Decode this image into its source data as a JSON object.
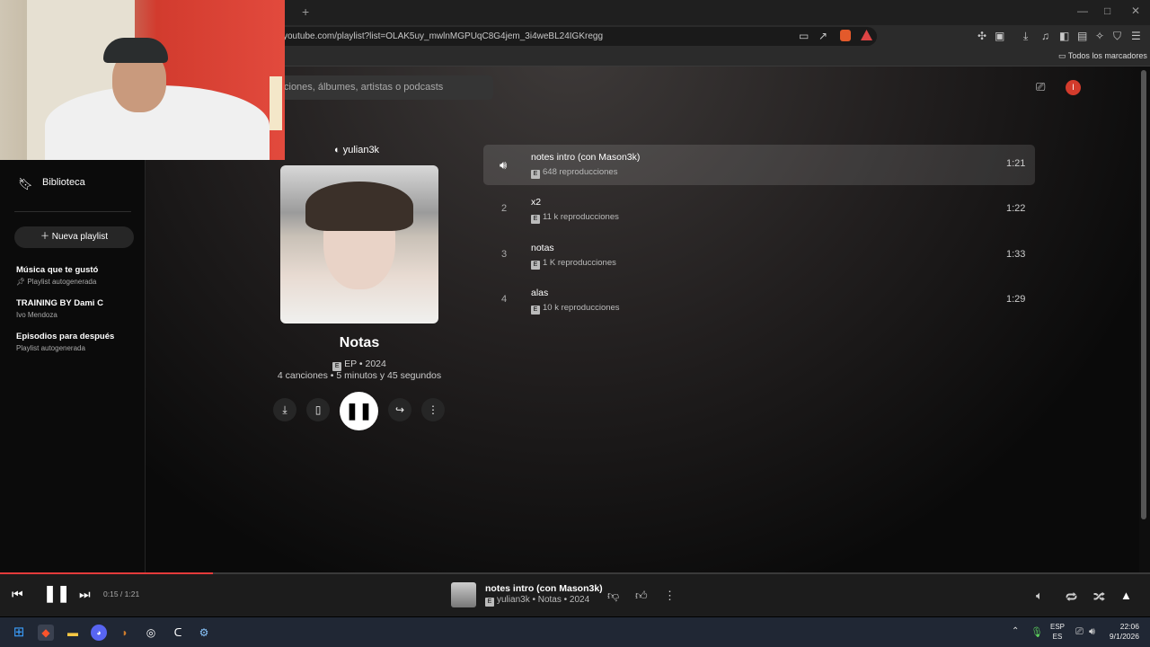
{
  "browser": {
    "url": "youtube.com/playlist?list=OLAK5uy_mwlnMGPUqC8G4jem_3i4weBL24IGKregg",
    "new_tab_label": "+",
    "bookmarks_label": "Todos los marcadores"
  },
  "header": {
    "search_placeholder": "ciones, álbumes, artistas o podcasts",
    "avatar_letter": "I"
  },
  "sidebar": {
    "library_label": "Biblioteca",
    "new_playlist_label": "Nueva playlist",
    "playlists": [
      {
        "title": "Música que te gustó",
        "subtitle": "Playlist autogenerada"
      },
      {
        "title": "TRAINING BY Dami C",
        "subtitle": "Ivo Mendoza"
      },
      {
        "title": "Episodios para después",
        "subtitle": "Playlist autogenerada"
      }
    ]
  },
  "album": {
    "artist": "yulian3k",
    "title": "Notas",
    "badge": "E",
    "type_year": "EP • 2024",
    "summary": "4 canciones • 5 minutos y 45 segundos"
  },
  "tracks": [
    {
      "number": "",
      "title": "notes intro (con Mason3k)",
      "plays": "648 reproducciones",
      "duration": "1:21"
    },
    {
      "number": "2",
      "title": "x2",
      "plays": "11 k reproducciones",
      "duration": "1:22"
    },
    {
      "number": "3",
      "title": "notas",
      "plays": "1 K reproducciones",
      "duration": "1:33"
    },
    {
      "number": "4",
      "title": "alas",
      "plays": "10 k reproducciones",
      "duration": "1:29"
    }
  ],
  "player": {
    "time": "0:15 / 1:21",
    "progress_fraction": 0.185,
    "title": "notes intro (con Mason3k)",
    "subtitle": "yulian3k • Notas • 2024"
  },
  "taskbar": {
    "lang_top": "ESP",
    "lang_bottom": "ES",
    "time": "22:06",
    "date": "9/1/2026"
  },
  "colors": {
    "accent": "#e43b3b",
    "avatar": "#d33b2c"
  },
  "icons": [
    "speaker-icon",
    "download-icon",
    "bookmark-icon",
    "share-icon",
    "more-icon",
    "cast-icon",
    "pause-icon"
  ]
}
